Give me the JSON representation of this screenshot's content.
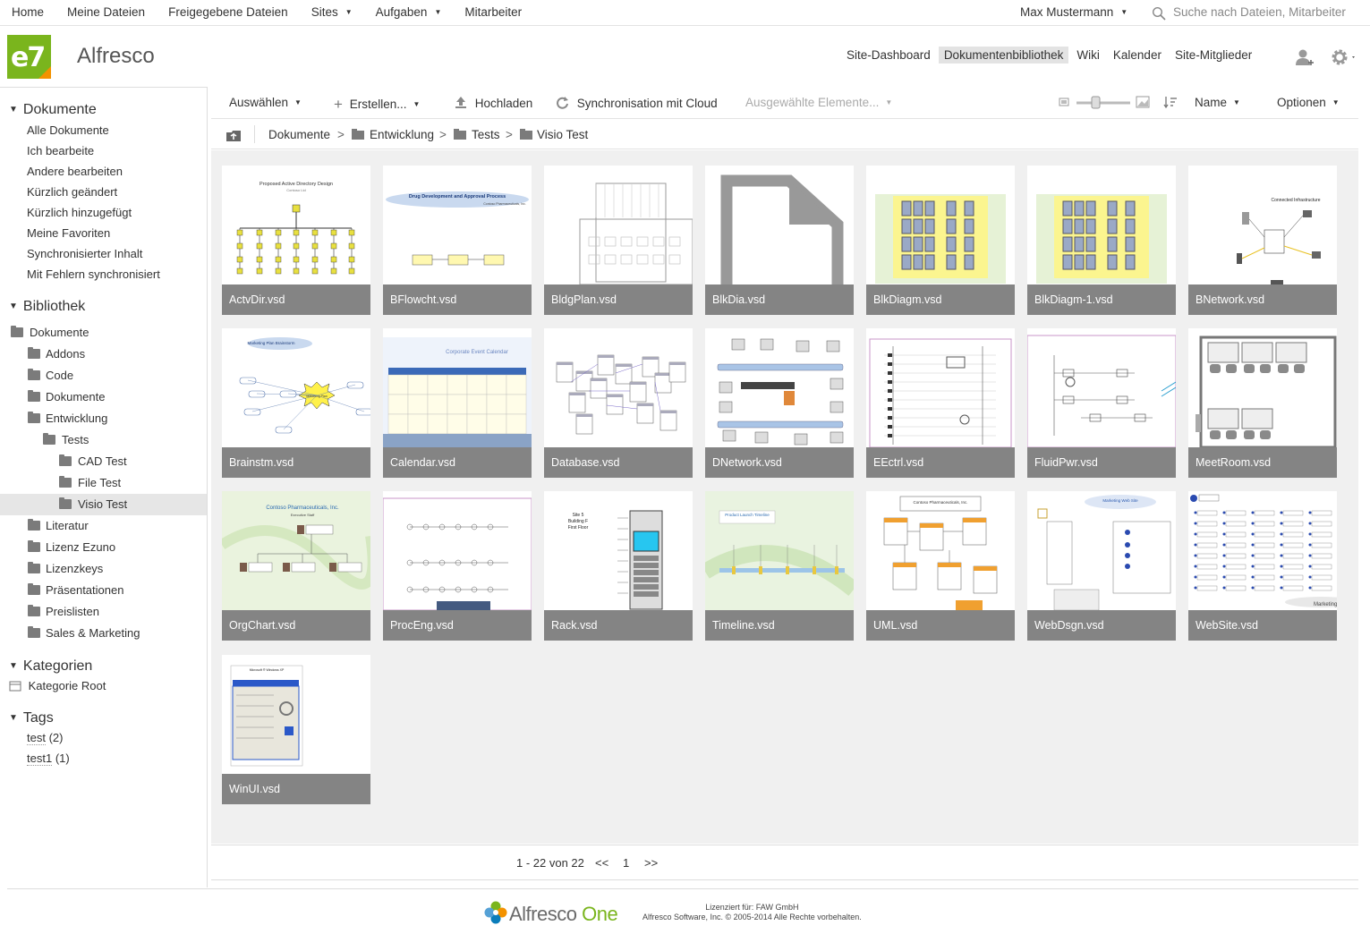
{
  "top_nav": {
    "items": [
      "Home",
      "Meine Dateien",
      "Freigegebene Dateien",
      "Sites",
      "Aufgaben",
      "Mitarbeiter"
    ],
    "user": "Max Mustermann",
    "search_placeholder": "Suche nach Dateien, Mitarbeiter"
  },
  "header": {
    "logo_text": "e7",
    "site_title": "Alfresco",
    "site_nav": [
      "Site-Dashboard",
      "Dokumentenbibliothek",
      "Wiki",
      "Kalender",
      "Site-Mitglieder"
    ],
    "active_nav": "Dokumentenbibliothek"
  },
  "sidebar": {
    "documents_heading": "Dokumente",
    "filters": [
      "Alle Dokumente",
      "Ich bearbeite",
      "Andere bearbeiten",
      "Kürzlich geändert",
      "Kürzlich hinzugefügt",
      "Meine Favoriten",
      "Synchronisierter Inhalt",
      "Mit Fehlern synchronisiert"
    ],
    "library_heading": "Bibliothek",
    "tree": [
      {
        "label": "Dokumente",
        "level": 0
      },
      {
        "label": "Addons",
        "level": 1
      },
      {
        "label": "Code",
        "level": 1
      },
      {
        "label": "Dokumente",
        "level": 1
      },
      {
        "label": "Entwicklung",
        "level": 1
      },
      {
        "label": "Tests",
        "level": 2
      },
      {
        "label": "CAD Test",
        "level": 3
      },
      {
        "label": "File Test",
        "level": 3
      },
      {
        "label": "Visio Test",
        "level": 3,
        "selected": true
      },
      {
        "label": "Literatur",
        "level": 1
      },
      {
        "label": "Lizenz Ezuno",
        "level": 1
      },
      {
        "label": "Lizenzkeys",
        "level": 1
      },
      {
        "label": "Präsentationen",
        "level": 1
      },
      {
        "label": "Preislisten",
        "level": 1
      },
      {
        "label": "Sales & Marketing",
        "level": 1
      }
    ],
    "categories_heading": "Kategorien",
    "category_root": "Kategorie Root",
    "tags_heading": "Tags",
    "tags": [
      {
        "name": "test",
        "count": "(2)"
      },
      {
        "name": "test1",
        "count": "(1)"
      }
    ]
  },
  "toolbar": {
    "select": "Auswählen",
    "create": "Erstellen...",
    "upload": "Hochladen",
    "sync": "Synchronisation mit Cloud",
    "selected_items": "Ausgewählte Elemente...",
    "sort": "Name",
    "options": "Optionen"
  },
  "breadcrumb": [
    "Dokumente",
    "Entwicklung",
    "Tests",
    "Visio Test"
  ],
  "files": [
    {
      "name": "ActvDir.vsd",
      "thumb": "tree"
    },
    {
      "name": "BFlowcht.vsd",
      "thumb": "flow"
    },
    {
      "name": "BldgPlan.vsd",
      "thumb": "plan"
    },
    {
      "name": "BlkDia.vsd",
      "thumb": "generic"
    },
    {
      "name": "BlkDiagm.vsd",
      "thumb": "block"
    },
    {
      "name": "BlkDiagm-1.vsd",
      "thumb": "block"
    },
    {
      "name": "BNetwork.vsd",
      "thumb": "network"
    },
    {
      "name": "Brainstm.vsd",
      "thumb": "brain"
    },
    {
      "name": "Calendar.vsd",
      "thumb": "calendar"
    },
    {
      "name": "Database.vsd",
      "thumb": "database"
    },
    {
      "name": "DNetwork.vsd",
      "thumb": "dnetwork"
    },
    {
      "name": "EEctrl.vsd",
      "thumb": "circuit"
    },
    {
      "name": "FluidPwr.vsd",
      "thumb": "circuit2"
    },
    {
      "name": "MeetRoom.vsd",
      "thumb": "meetroom"
    },
    {
      "name": "OrgChart.vsd",
      "thumb": "orgchart"
    },
    {
      "name": "ProcEng.vsd",
      "thumb": "proceng"
    },
    {
      "name": "Rack.vsd",
      "thumb": "rack"
    },
    {
      "name": "Timeline.vsd",
      "thumb": "timeline"
    },
    {
      "name": "UML.vsd",
      "thumb": "uml"
    },
    {
      "name": "WebDsgn.vsd",
      "thumb": "webdsgn"
    },
    {
      "name": "WebSite.vsd",
      "thumb": "website"
    },
    {
      "name": "WinUI.vsd",
      "thumb": "winui"
    }
  ],
  "thumb_text": {
    "ActvDir.vsd": [
      "Proposed Active Directory Design",
      "Contoso Ltd"
    ],
    "BFlowcht.vsd": [
      "Drug Development and Approval Process",
      "Contoso Pharmaceuticals, Inc."
    ],
    "BNetwork.vsd": [
      "Connected Infrastructure"
    ],
    "Brainstm.vsd": [
      "Marketing Plan Brainstorm",
      "Marketing Plan"
    ],
    "Calendar.vsd": [
      "Corporate Event Calendar"
    ],
    "OrgChart.vsd": [
      "Contoso Pharmaceuticals, Inc.",
      "Executive Staff"
    ],
    "Rack.vsd": [
      "Site 5",
      "Building F",
      "First Floor"
    ],
    "Timeline.vsd": [
      "Product Launch Timeline"
    ],
    "UML.vsd": [
      "Contoso Pharmaceuticals, Inc."
    ],
    "WebDsgn.vsd": [
      "Marketing Web Site"
    ],
    "WebSite.vsd": [
      "Marketing W"
    ],
    "WinUI.vsd": [
      "Microsoft ® Windows XP"
    ]
  },
  "pagination": {
    "range": "1 - 22 von 22",
    "prev": "<<",
    "page": "1",
    "next": ">>"
  },
  "footer": {
    "logo_word": "Alfresco",
    "logo_one": "One",
    "license": "Lizenziert für: FAW GmbH",
    "copyright": "Alfresco Software, Inc. © 2005-2014 Alle Rechte vorbehalten."
  },
  "colors": {
    "brand_green": "#7ab51d",
    "brand_orange": "#f39200",
    "caption_bg": "#6e6e6e"
  }
}
